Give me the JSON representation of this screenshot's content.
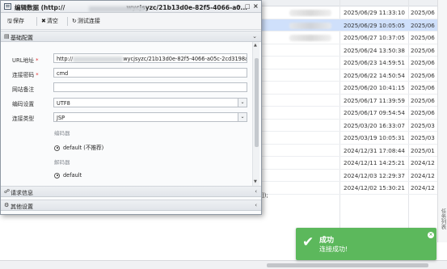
{
  "dialog": {
    "title": "编辑数据 (http://",
    "title_tail": "wycjsyzc/21b13d0e-82f5-4066-a0...",
    "controls": {
      "min": "–",
      "max": "□",
      "close": "×"
    },
    "toolbar": {
      "save": "保存",
      "clear": "清空",
      "test": "测试连接"
    },
    "panels": {
      "basic": "基础配置",
      "request": "请求信息",
      "other": "其他设置"
    },
    "form": {
      "url_label": "URL地址",
      "url_prefix": "http://",
      "url_suffix": "wycjsyzc/21b13d0e-82f5-4066-a05c-2cd3198a",
      "password_label": "连接密码",
      "password_value": "cmd",
      "note_label": "网站备注",
      "note_value": "",
      "encoding_label": "编码设置",
      "encoding_value": "UTF8",
      "type_label": "连接类型",
      "type_value": "JSP",
      "encoder_label": "编码器",
      "encoder_option": "default (不推荐)",
      "decoder_label": "解码器",
      "decoder_option": "default"
    }
  },
  "background": {
    "dates": [
      "2025/06/29 11:33:10",
      "2025/06/29 10:05:05",
      "2025/06/27 10:37:05",
      "2025/06/24 13:50:38",
      "2025/06/23 14:59:51",
      "2025/06/22 14:50:54",
      "2025/06/20 10:41:15",
      "2025/06/17 11:39:59",
      "2025/06/17 09:54:54",
      "2025/03/20 16:33:07",
      "2025/03/19 10:05:31",
      "2024/12/31 17:08:44",
      "2024/12/11 14:25:21",
      "2024/12/03 12:29:37",
      "2024/12/02 15:30:21"
    ],
    "date_col2": [
      "2025/06",
      "2025/06",
      "2025/06",
      "2025/06",
      "2025/06",
      "2025/06",
      "2025/06",
      "2025/06",
      "2025/06",
      "2025/03",
      "2025/03",
      "2025/01",
      "2024/12",
      "2024/12",
      "2024/12"
    ],
    "code_snippet": "]);",
    "side_label": "任务列表"
  },
  "toast": {
    "title": "成功",
    "message": "连接成功!",
    "close": "×",
    "color": "#5cb85c"
  }
}
